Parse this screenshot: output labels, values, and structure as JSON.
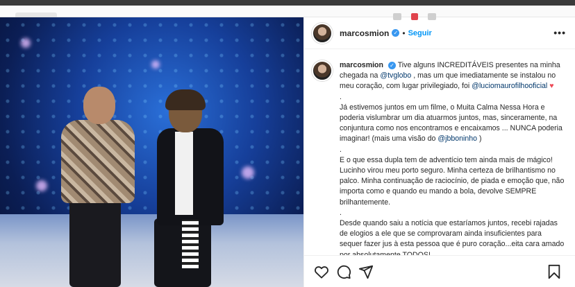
{
  "post": {
    "username": "marcosmion",
    "follow_label": "Seguir",
    "dot": "•",
    "more_label": "•••",
    "caption": {
      "author": "marcosmion",
      "line1": "Tive alguns INCREDITÁVEIS presentes na minha chegada na",
      "mention_globo": "@tvglobo",
      "line2": ", mas um que imediatamente se instalou no meu coração, com lugar privilegiado, foi",
      "mention_lucio": "@luciomaurofilhooficial",
      "heart": "♥",
      "sep1": ".",
      "para2a": "Já estivemos juntos em um filme, o Muita Calma Nessa Hora e poderia vislumbrar um dia atuarmos juntos, mas, sinceramente, na conjuntura como nos encontramos e encaixamos ... NUNCA poderia imaginar!",
      "para2b": "(mais uma visão do",
      "mention_jb": "@jbboninho",
      "para2c": ")",
      "sep2": ".",
      "para3": "E o que essa dupla tem de adventício tem ainda mais de mágico! Lucinho virou meu porto seguro. Minha certeza de brilhantismo no palco. Minha continuação de raciocínio, de piada e emoção que, não importa como e quando eu mando a bola, devolve SEMPRE brilhantemente.",
      "sep3": ".",
      "para4": "Desde quando saiu a notícia que estaríamos juntos, recebi rajadas de elogios a ele que se comprovaram ainda insuficientes para sequer fazer jus à esta pessoa que é puro coração...eita cara amado por absolutamente TODOS!"
    }
  },
  "icons": {
    "like": "heart-icon",
    "comment": "comment-icon",
    "share": "share-icon",
    "save": "bookmark-icon",
    "verified": "verified-badge-icon"
  },
  "colors": {
    "accent": "#0095f6",
    "verified": "#3897f0",
    "heart": "#ed4956",
    "mention": "#00376b"
  }
}
